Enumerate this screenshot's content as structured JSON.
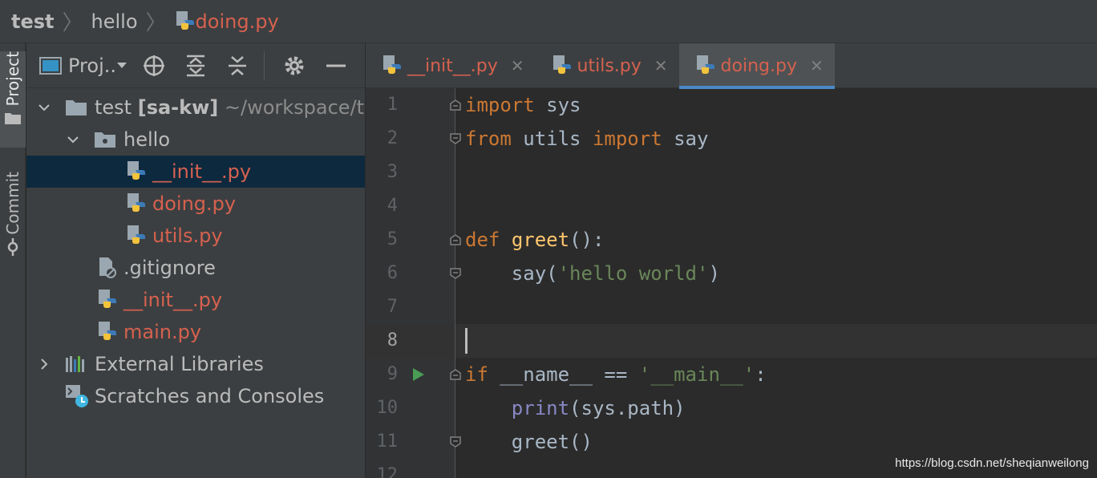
{
  "breadcrumb": {
    "root": "test",
    "folder": "hello",
    "file": "doing.py"
  },
  "tool_stripe": {
    "project": "Project",
    "commit": "Commit"
  },
  "project_panel": {
    "title": "Proj..",
    "tree": [
      {
        "name": "test",
        "extra": "[sa-kw]",
        "path": "~/workspace/t",
        "kind": "folder",
        "expanded": true
      },
      {
        "name": "hello",
        "kind": "package",
        "expanded": true
      },
      {
        "name": "__init__.py",
        "kind": "py",
        "selected": true
      },
      {
        "name": "doing.py",
        "kind": "py"
      },
      {
        "name": "utils.py",
        "kind": "py"
      },
      {
        "name": ".gitignore",
        "kind": "ignored"
      },
      {
        "name": "__init__.py",
        "kind": "py"
      },
      {
        "name": "main.py",
        "kind": "py"
      },
      {
        "name": "External Libraries",
        "kind": "libs",
        "expanded": false
      },
      {
        "name": "Scratches and Consoles",
        "kind": "scratches"
      }
    ]
  },
  "tabs": [
    {
      "label": "__init__.py",
      "active": false
    },
    {
      "label": "utils.py",
      "active": false
    },
    {
      "label": "doing.py",
      "active": true
    }
  ],
  "code": {
    "line_numbers": [
      "1",
      "2",
      "3",
      "4",
      "5",
      "6",
      "7",
      "8",
      "9",
      "10",
      "11",
      "12"
    ],
    "lines": [
      "import sys",
      "from utils import say",
      "",
      "",
      "def greet():",
      "    say('hello world')",
      "",
      "",
      "if __name__ == '__main__':",
      "    print(sys.path)",
      "    greet()",
      ""
    ],
    "current_line": 8,
    "run_marker_line": 9
  },
  "colors": {
    "keyword": "#cc7832",
    "function": "#ffc66d",
    "string": "#6a8759",
    "builtin": "#8888c6",
    "modified_file": "#d6614f",
    "run_green": "#499c54",
    "selection": "#0d293e",
    "tab_underline": "#4a88c7"
  },
  "watermark": "https://blog.csdn.net/sheqianweilong"
}
